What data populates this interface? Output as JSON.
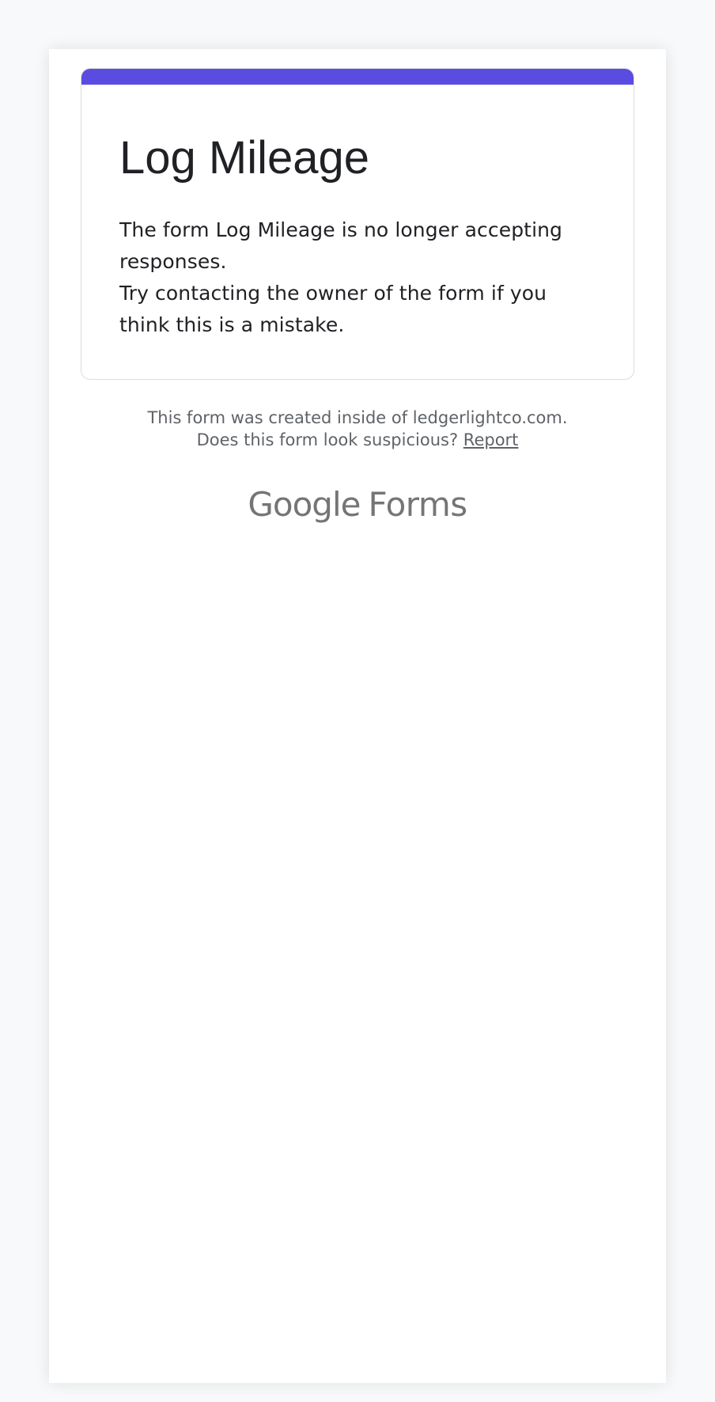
{
  "form": {
    "title": "Log Mileage",
    "message_line1": "The form Log Mileage is no longer accepting responses.",
    "message_line2": "Try contacting the owner of the form if you think this is a mistake."
  },
  "footer": {
    "created_inside": "This form was created inside of ledgerlightco.com.",
    "suspicious_prompt": "Does this form look suspicious?",
    "report_label": "Report"
  },
  "brand": {
    "google": "Google",
    "product": "Forms"
  },
  "colors": {
    "accent": "#5b4ce1"
  }
}
